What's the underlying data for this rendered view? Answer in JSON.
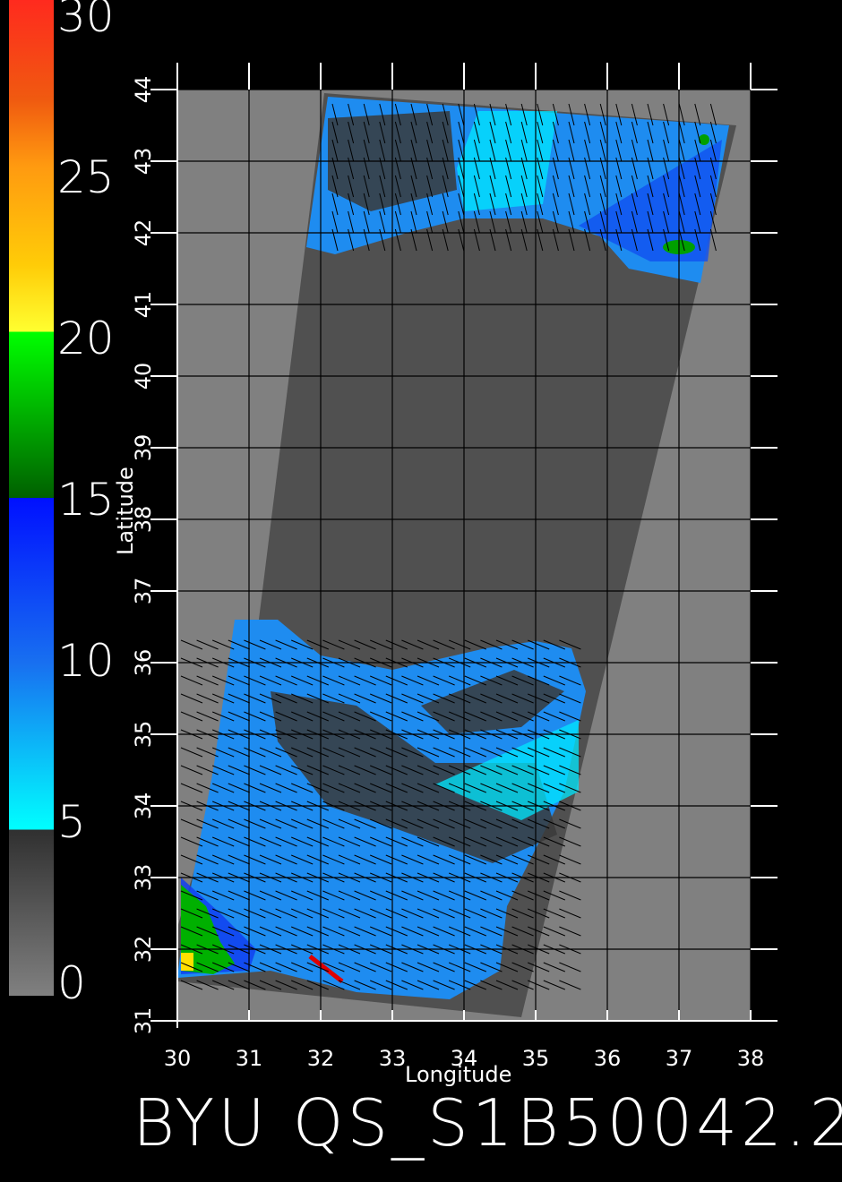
{
  "colorbar": {
    "labels": [
      "30",
      "25",
      "20",
      "15",
      "10",
      "5",
      "0"
    ],
    "stops": [
      {
        "value": 30,
        "color": "#ff2a1e"
      },
      {
        "value": 27,
        "color": "#f05a10"
      },
      {
        "value": 25,
        "color": "#ff9a10"
      },
      {
        "value": 22,
        "color": "#ffcc08"
      },
      {
        "value": 20,
        "color": "#ffff30"
      },
      {
        "value": 20,
        "color": "#00ff00"
      },
      {
        "value": 15,
        "color": "#006000"
      },
      {
        "value": 15,
        "color": "#0010ff"
      },
      {
        "value": 10,
        "color": "#1870f0"
      },
      {
        "value": 5,
        "color": "#00ffff"
      },
      {
        "value": 5,
        "color": "#303030"
      },
      {
        "value": 0,
        "color": "#808080"
      }
    ]
  },
  "axes": {
    "xlabel": "Longitude",
    "ylabel": "Latitude",
    "x_ticks": [
      "30",
      "31",
      "32",
      "33",
      "34",
      "35",
      "36",
      "37",
      "38"
    ],
    "y_ticks": [
      "31",
      "32",
      "33",
      "34",
      "35",
      "36",
      "37",
      "38",
      "39",
      "40",
      "41",
      "42",
      "43",
      "44"
    ],
    "xlim": [
      30,
      38
    ],
    "ylim": [
      31,
      44
    ]
  },
  "map_colors": {
    "background": "#808080",
    "swath": "#505050",
    "grid": "#000000",
    "frame": "#ffffff"
  },
  "footer": {
    "text": "BYU  QS_S1B50042.2"
  }
}
